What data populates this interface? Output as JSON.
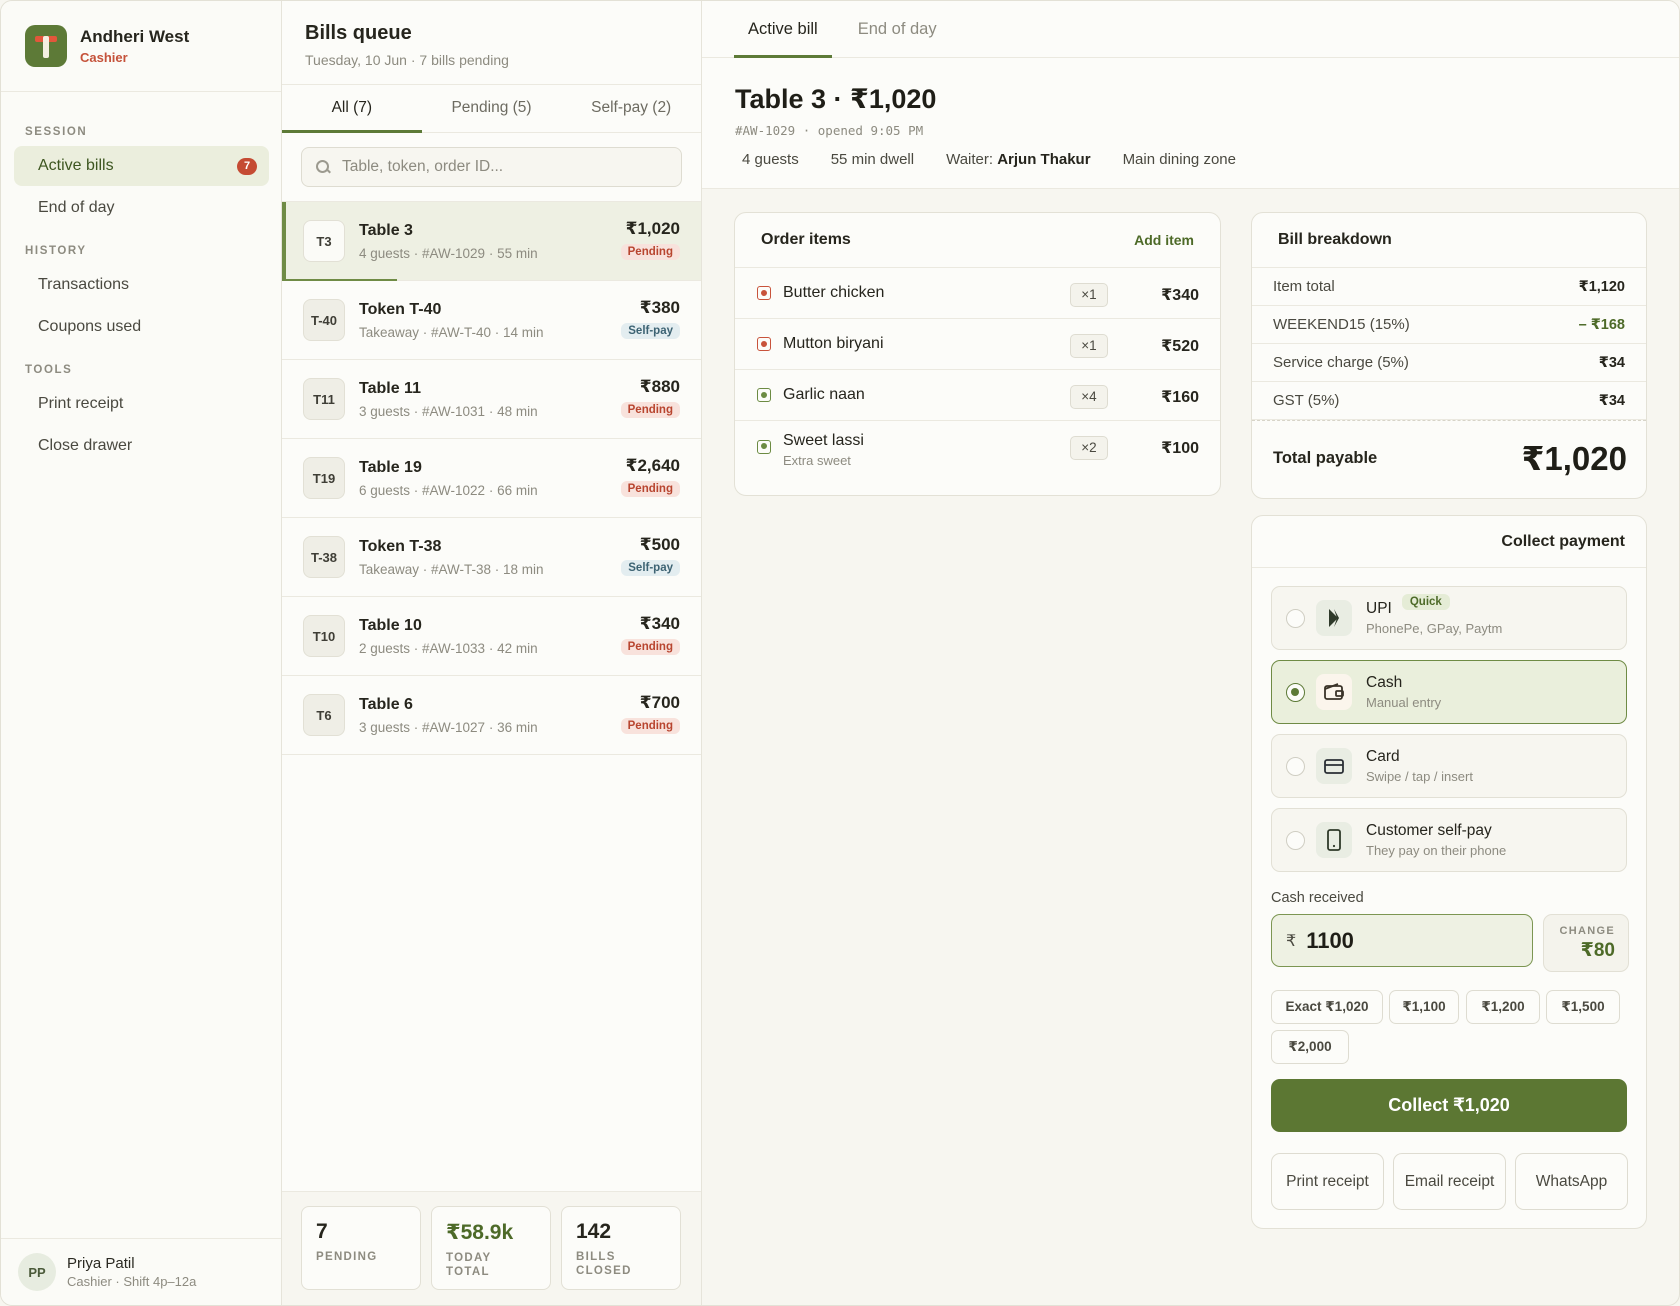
{
  "sidebar": {
    "brand": {
      "name": "Andheri West",
      "role": "Cashier"
    },
    "sections": {
      "session": "SESSION",
      "history": "HISTORY",
      "tools": "TOOLS"
    },
    "items": {
      "active_bills": {
        "label": "Active bills",
        "badge": "7"
      },
      "end_of_day": {
        "label": "End of day"
      },
      "transactions": {
        "label": "Transactions"
      },
      "coupons_used": {
        "label": "Coupons used"
      },
      "print_receipt": {
        "label": "Print receipt"
      },
      "close_drawer": {
        "label": "Close drawer"
      }
    },
    "user": {
      "initials": "PP",
      "name": "Priya Patil",
      "sub": "Cashier · Shift 4p–12a"
    }
  },
  "queue": {
    "title": "Bills queue",
    "subtitle": "Tuesday, 10 Jun · 7 bills pending",
    "tabs": [
      "All (7)",
      "Pending (5)",
      "Self-pay (2)"
    ],
    "search_placeholder": "Table, token, order ID...",
    "bills": [
      {
        "token": "T3",
        "name": "Table 3",
        "meta": "4 guests · #AW-1029 · 55 min",
        "amount": "₹1,020",
        "status": "Pending",
        "kind": "pending",
        "active": true
      },
      {
        "token": "T-40",
        "name": "Token T-40",
        "meta": "Takeaway · #AW-T-40 · 14 min",
        "amount": "₹380",
        "status": "Self-pay",
        "kind": "selfpay"
      },
      {
        "token": "T11",
        "name": "Table 11",
        "meta": "3 guests · #AW-1031 · 48 min",
        "amount": "₹880",
        "status": "Pending",
        "kind": "pending"
      },
      {
        "token": "T19",
        "name": "Table 19",
        "meta": "6 guests · #AW-1022 · 66 min",
        "amount": "₹2,640",
        "status": "Pending",
        "kind": "pending"
      },
      {
        "token": "T-38",
        "name": "Token T-38",
        "meta": "Takeaway · #AW-T-38 · 18 min",
        "amount": "₹500",
        "status": "Self-pay",
        "kind": "selfpay"
      },
      {
        "token": "T10",
        "name": "Table 10",
        "meta": "2 guests · #AW-1033 · 42 min",
        "amount": "₹340",
        "status": "Pending",
        "kind": "pending"
      },
      {
        "token": "T6",
        "name": "Table 6",
        "meta": "3 guests · #AW-1027 · 36 min",
        "amount": "₹700",
        "status": "Pending",
        "kind": "pending"
      }
    ],
    "stats": [
      {
        "value": "7",
        "label": "PENDING"
      },
      {
        "value": "₹58.9k",
        "label": "TODAY TOTAL"
      },
      {
        "value": "142",
        "label": "BILLS CLOSED"
      }
    ]
  },
  "main": {
    "tabs": [
      "Active bill",
      "End of day"
    ],
    "bill": {
      "title": "Table 3 · ₹1,020",
      "id_line": "#AW-1029 · opened 9:05 PM",
      "guests": "4 guests",
      "dwell": "55 min dwell",
      "waiter_label": "Waiter:",
      "waiter_name": "Arjun Thakur",
      "zone": "Main dining zone"
    },
    "order": {
      "title": "Order items",
      "add_label": "Add item",
      "items": [
        {
          "name": "Butter chicken",
          "qty": "×1",
          "price": "₹340",
          "veg": false,
          "note": ""
        },
        {
          "name": "Mutton biryani",
          "qty": "×1",
          "price": "₹520",
          "veg": false,
          "note": ""
        },
        {
          "name": "Garlic naan",
          "qty": "×4",
          "price": "₹160",
          "veg": true,
          "note": ""
        },
        {
          "name": "Sweet lassi",
          "qty": "×2",
          "price": "₹100",
          "veg": true,
          "note": "Extra sweet"
        }
      ]
    },
    "breakdown": {
      "title": "Bill breakdown",
      "rows": [
        {
          "label": "Item total",
          "value": "₹1,120"
        },
        {
          "label": "WEEKEND15 (15%)",
          "value": "– ₹168",
          "discount": true
        },
        {
          "label": "Service charge (5%)",
          "value": "₹34"
        },
        {
          "label": "GST (5%)",
          "value": "₹34"
        }
      ],
      "total_label": "Total payable",
      "total_value": "₹1,020"
    },
    "payment": {
      "title": "Collect payment",
      "methods": [
        {
          "name": "UPI",
          "sub": "PhonePe, GPay, Paytm",
          "badge": "Quick",
          "icon": "upi-icon",
          "selected": false
        },
        {
          "name": "Cash",
          "sub": "Manual entry",
          "icon": "wallet-icon",
          "selected": true
        },
        {
          "name": "Card",
          "sub": "Swipe / tap / insert",
          "icon": "card-icon",
          "selected": false
        },
        {
          "name": "Customer self-pay",
          "sub": "They pay on their phone",
          "icon": "phone-icon",
          "selected": false
        }
      ],
      "cash_label": "Cash received",
      "currency": "₹",
      "cash_value": "1100",
      "change_label": "CHANGE",
      "change_value": "₹80",
      "chips": [
        "Exact ₹1,020",
        "₹1,100",
        "₹1,200",
        "₹1,500",
        "₹2,000"
      ],
      "collect_label": "Collect ₹1,020",
      "actions": [
        "Print receipt",
        "Email receipt",
        "WhatsApp"
      ]
    },
    "colors": {
      "accent": "#5c7733",
      "pending": "#b8452f",
      "selfpay": "#3d6373",
      "brand_red": "#c5523a"
    }
  }
}
